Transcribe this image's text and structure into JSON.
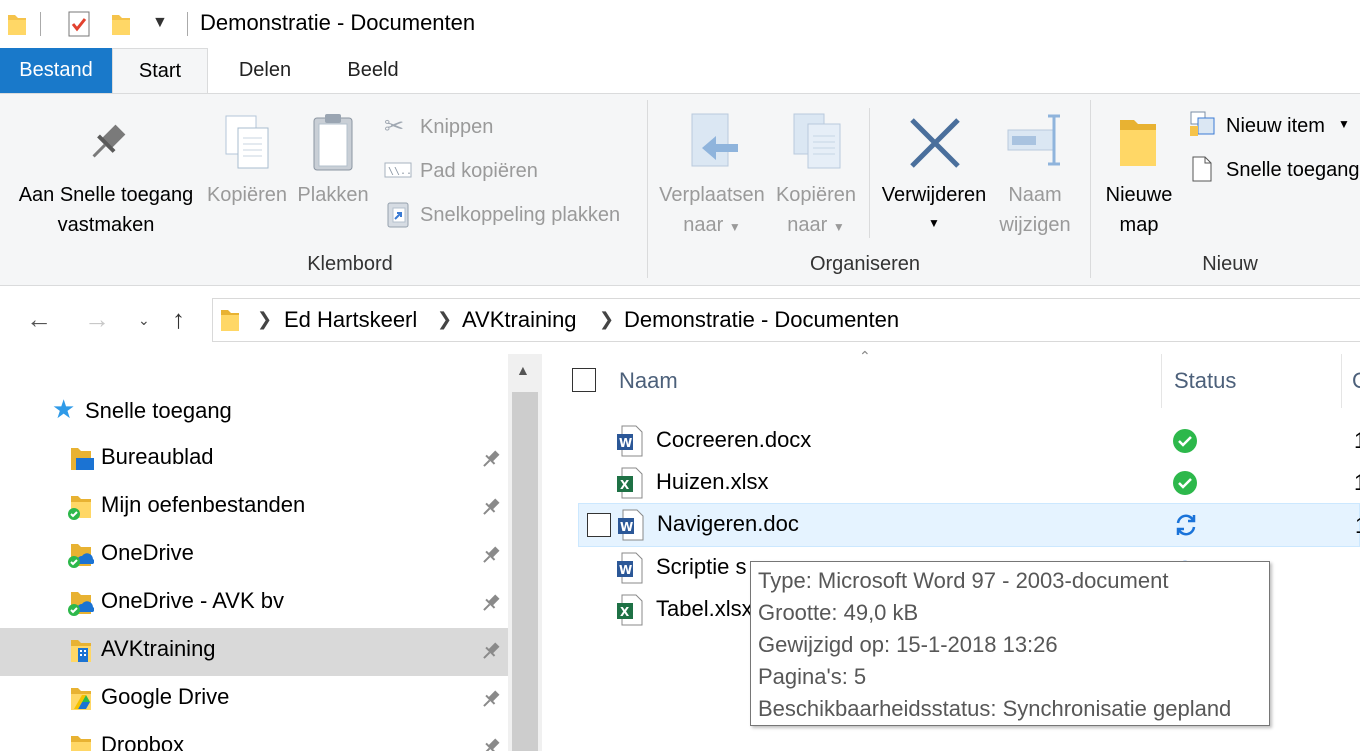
{
  "window": {
    "title": "Demonstratie - Documenten"
  },
  "ribbon_tabs": {
    "file": "Bestand",
    "start": "Start",
    "share": "Delen",
    "view": "Beeld"
  },
  "clipboard": {
    "pin_line1": "Aan Snelle toegang",
    "pin_line2": "vastmaken",
    "copy": "Kopiëren",
    "paste": "Plakken",
    "cut": "Knippen",
    "copy_path": "Pad kopiëren",
    "paste_shortcut": "Snelkoppeling plakken",
    "group": "Klembord"
  },
  "organize": {
    "move_line1": "Verplaatsen",
    "move_line2": "naar",
    "copyto_line1": "Kopiëren",
    "copyto_line2": "naar",
    "delete": "Verwijderen",
    "rename_line1": "Naam",
    "rename_line2": "wijzigen",
    "group": "Organiseren"
  },
  "new": {
    "newfolder_line1": "Nieuwe",
    "newfolder_line2": "map",
    "new_item": "Nieuw item",
    "easy_access": "Snelle toegang",
    "group": "Nieuw"
  },
  "breadcrumb": [
    "Ed Hartskeerl",
    "AVKtraining",
    "Demonstratie - Documenten"
  ],
  "nav": {
    "quick_access": "Snelle toegang",
    "items": [
      {
        "label": "Bureaublad"
      },
      {
        "label": "Mijn oefenbestanden"
      },
      {
        "label": "OneDrive"
      },
      {
        "label": "OneDrive - AVK bv"
      },
      {
        "label": "AVKtraining"
      },
      {
        "label": "Google Drive"
      },
      {
        "label": "Dropbox"
      }
    ]
  },
  "columns": {
    "name": "Naam",
    "status": "Status",
    "next_partial": "G"
  },
  "files": [
    {
      "name": "Cocreeren.docx",
      "type": "word",
      "status": "synced"
    },
    {
      "name": "Huizen.xlsx",
      "type": "excel",
      "status": "synced"
    },
    {
      "name": "Navigeren.doc",
      "type": "word",
      "status": "sync-pending"
    },
    {
      "name": "Scriptie s",
      "type": "word",
      "status": "unknown"
    },
    {
      "name": "Tabel.xlsx",
      "type": "excel",
      "status": "none"
    }
  ],
  "tooltip": {
    "type": "Type: Microsoft Word 97 - 2003-document",
    "size": "Grootte: 49,0 kB",
    "modified": "Gewijzigd op: 15-1-2018 13:26",
    "pages": "Pagina's: 5",
    "availability": "Beschikbaarheidsstatus: Synchronisatie gepland"
  },
  "colors": {
    "accent": "#1979ca",
    "green": "#2db84b",
    "sync_blue": "#1a73d9",
    "folder": "#f5c34b"
  }
}
